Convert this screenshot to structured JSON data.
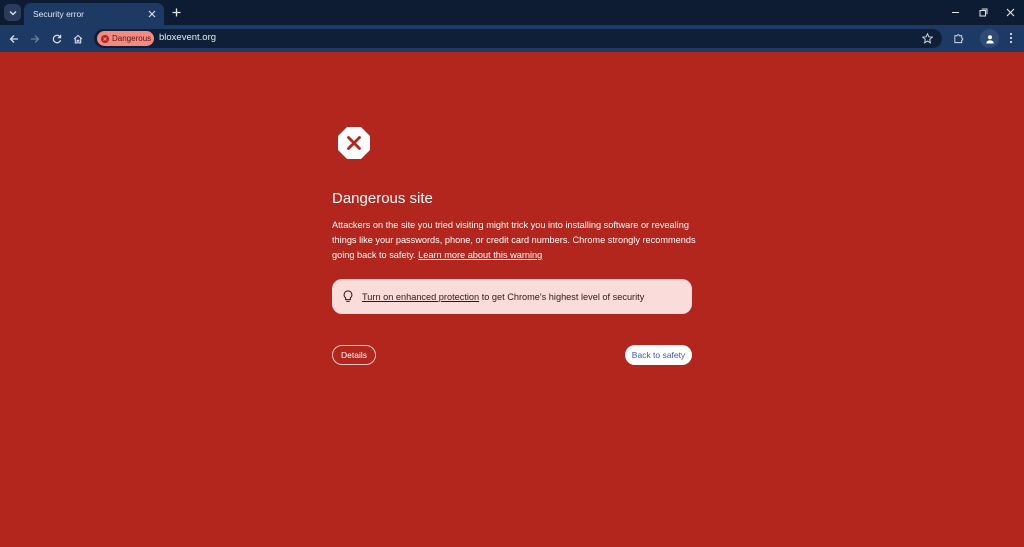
{
  "browser": {
    "tab_title": "Security error",
    "address_chip": "Dangerous",
    "url": "bloxevent.org"
  },
  "interstitial": {
    "heading": "Dangerous site",
    "description_text": "Attackers on the site you tried visiting might trick you into installing software or revealing things like your passwords, phone, or credit card numbers. Chrome strongly recommends going back to safety.",
    "learn_more_link": "Learn more about this warning",
    "protection_link": "Turn on enhanced protection",
    "protection_rest": " to get Chrome's highest level of security",
    "details_button": "Details",
    "back_button": "Back to safety"
  },
  "colors": {
    "page_bg": "#b3261e",
    "chrome_frame": "#0e1c33",
    "toolbar": "#1c3a63",
    "chip": "#f28b82",
    "protect_box": "#fadcda",
    "button_text": "#3a58c2"
  },
  "icons": {
    "tab_search": "chevron-down-icon",
    "new_tab": "plus-icon",
    "back": "arrow-left-icon",
    "forward": "arrow-right-icon",
    "reload": "reload-icon",
    "home": "home-icon",
    "bookmark": "star-icon",
    "extensions": "puzzle-icon",
    "profile": "person-icon",
    "menu": "kebab-menu-icon",
    "warning": "octagon-x-icon",
    "tip": "lightbulb-icon"
  }
}
